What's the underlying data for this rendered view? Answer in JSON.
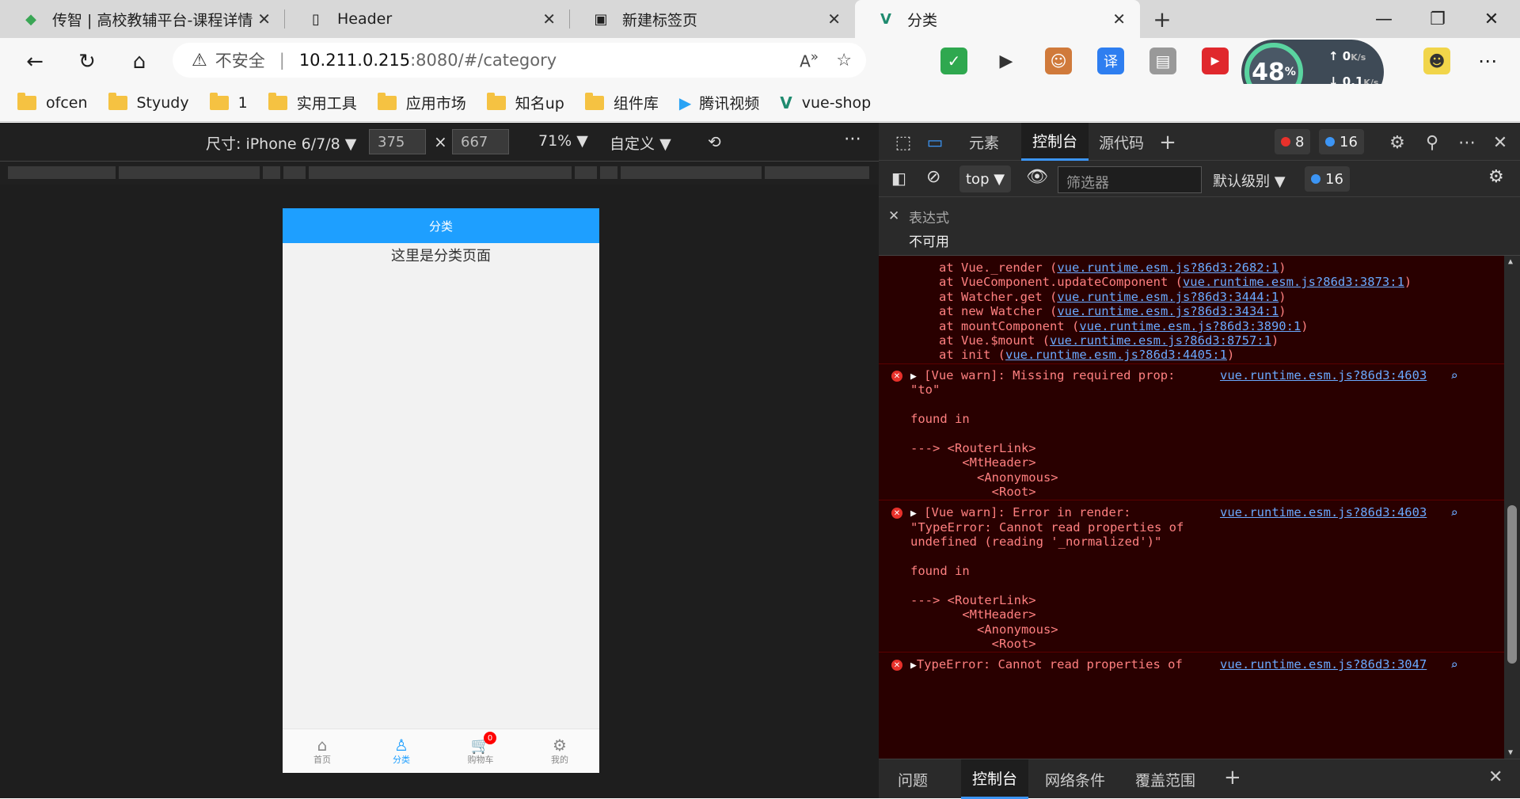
{
  "tabs": [
    {
      "title": "传智 | 高校教辅平台-课程详情",
      "icon": "chuanzhi-logo-icon"
    },
    {
      "title": "Header",
      "icon": "page-icon"
    },
    {
      "title": "新建标签页",
      "icon": "newtab-icon"
    },
    {
      "title": "分类",
      "icon": "vue-logo-icon"
    }
  ],
  "address": {
    "security_label": "不安全",
    "host": "10.211.0.215",
    "rest": ":8080/#/category"
  },
  "perf": {
    "percent": "48",
    "percent_unit": "%",
    "upload": "0",
    "upload_unit": "K/s",
    "download": "0.1",
    "download_unit": "K/s"
  },
  "bookmarks": [
    "ofcen",
    "Styudy",
    "1",
    "实用工具",
    "应用市场",
    "知名up",
    "组件库",
    "腾讯视频",
    "vue-shop"
  ],
  "device_toolbar": {
    "size_label": "尺寸: iPhone 6/7/8",
    "width": "375",
    "height": "667",
    "times": "×",
    "zoom": "71%",
    "throttle": "自定义"
  },
  "phone": {
    "header_title": "分类",
    "body_text": "这里是分类页面",
    "nav": [
      {
        "label": "首页",
        "icon": "home-icon"
      },
      {
        "label": "分类",
        "icon": "category-icon"
      },
      {
        "label": "购物车",
        "icon": "cart-icon"
      },
      {
        "label": "我的",
        "icon": "settings-icon"
      }
    ],
    "cart_badge": "0"
  },
  "devtools": {
    "tabs": [
      "元素",
      "控制台",
      "源代码"
    ],
    "active_tab": "控制台",
    "error_count": "8",
    "message_count": "16",
    "context": "top",
    "filter_placeholder": "筛选器",
    "level": "默认级别",
    "level_count": "16",
    "expression_label": "表达式",
    "expression_value": "不可用",
    "drawer_tabs": [
      "问题",
      "控制台",
      "网络条件",
      "覆盖范围"
    ]
  },
  "console": {
    "stack": [
      {
        "text": "at Vue._render (",
        "link": "vue.runtime.esm.js?86d3:2682:1",
        "end": ")"
      },
      {
        "text": "at VueComponent.updateComponent (",
        "link": "vue.runtime.esm.js?86d3:3873:1",
        "end": ")"
      },
      {
        "text": "at Watcher.get (",
        "link": "vue.runtime.esm.js?86d3:3444:1",
        "end": ")"
      },
      {
        "text": "at new Watcher (",
        "link": "vue.runtime.esm.js?86d3:3434:1",
        "end": ")"
      },
      {
        "text": "at mountComponent (",
        "link": "vue.runtime.esm.js?86d3:3890:1",
        "end": ")"
      },
      {
        "text": "at Vue.$mount (",
        "link": "vue.runtime.esm.js?86d3:8757:1",
        "end": ")"
      },
      {
        "text": "at init (",
        "link": "vue.runtime.esm.js?86d3:4405:1",
        "end": ")"
      }
    ],
    "msg1": {
      "l1": "[Vue warn]: Missing required prop:",
      "l2": "\"to\"",
      "found": "found in",
      "tree": [
        "---> <RouterLink>",
        "       <MtHeader>",
        "         <Anonymous>",
        "           <Root>"
      ],
      "link": "vue.runtime.esm.js?86d3:4603"
    },
    "msg2": {
      "l1": "[Vue warn]: Error in render:",
      "l2": "\"TypeError: Cannot read properties of",
      "l3": "undefined (reading '_normalized')\"",
      "found": "found in",
      "tree": [
        "---> <RouterLink>",
        "       <MtHeader>",
        "         <Anonymous>",
        "           <Root>"
      ],
      "link": "vue.runtime.esm.js?86d3:4603"
    },
    "msg3": {
      "l1": "TypeError: Cannot read properties of",
      "link": "vue.runtime.esm.js?86d3:3047"
    }
  }
}
